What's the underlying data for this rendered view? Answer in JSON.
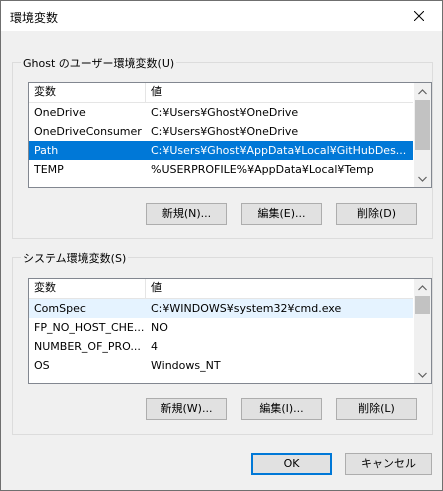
{
  "window": {
    "title": "環境変数"
  },
  "user_section": {
    "label": "Ghost のユーザー環境変数(U)",
    "columns": {
      "name": "変数",
      "value": "値"
    },
    "rows": [
      {
        "name": "OneDrive",
        "value": "C:¥Users¥Ghost¥OneDrive"
      },
      {
        "name": "OneDriveConsumer",
        "value": "C:¥Users¥Ghost¥OneDrive"
      },
      {
        "name": "Path",
        "value": "C:¥Users¥Ghost¥AppData¥Local¥GitHubDes..."
      },
      {
        "name": "TEMP",
        "value": "%USERPROFILE%¥AppData¥Local¥Temp"
      }
    ],
    "selected_row": 2,
    "buttons": {
      "new": "新規(N)...",
      "edit": "編集(E)...",
      "delete": "削除(D)"
    }
  },
  "system_section": {
    "label": "システム環境変数(S)",
    "columns": {
      "name": "変数",
      "value": "値"
    },
    "rows": [
      {
        "name": "ComSpec",
        "value": "C:¥WINDOWS¥system32¥cmd.exe"
      },
      {
        "name": "FP_NO_HOST_CHE...",
        "value": "NO"
      },
      {
        "name": "NUMBER_OF_PRO...",
        "value": "4"
      },
      {
        "name": "OS",
        "value": "Windows_NT"
      }
    ],
    "hover_row": 0,
    "buttons": {
      "new": "新規(W)...",
      "edit": "編集(I)...",
      "delete": "削除(L)"
    }
  },
  "footer": {
    "ok": "OK",
    "cancel": "キャンセル"
  },
  "colors": {
    "selection": "#0078d7",
    "hover": "#e5f3ff",
    "accent": "#0078d7"
  }
}
